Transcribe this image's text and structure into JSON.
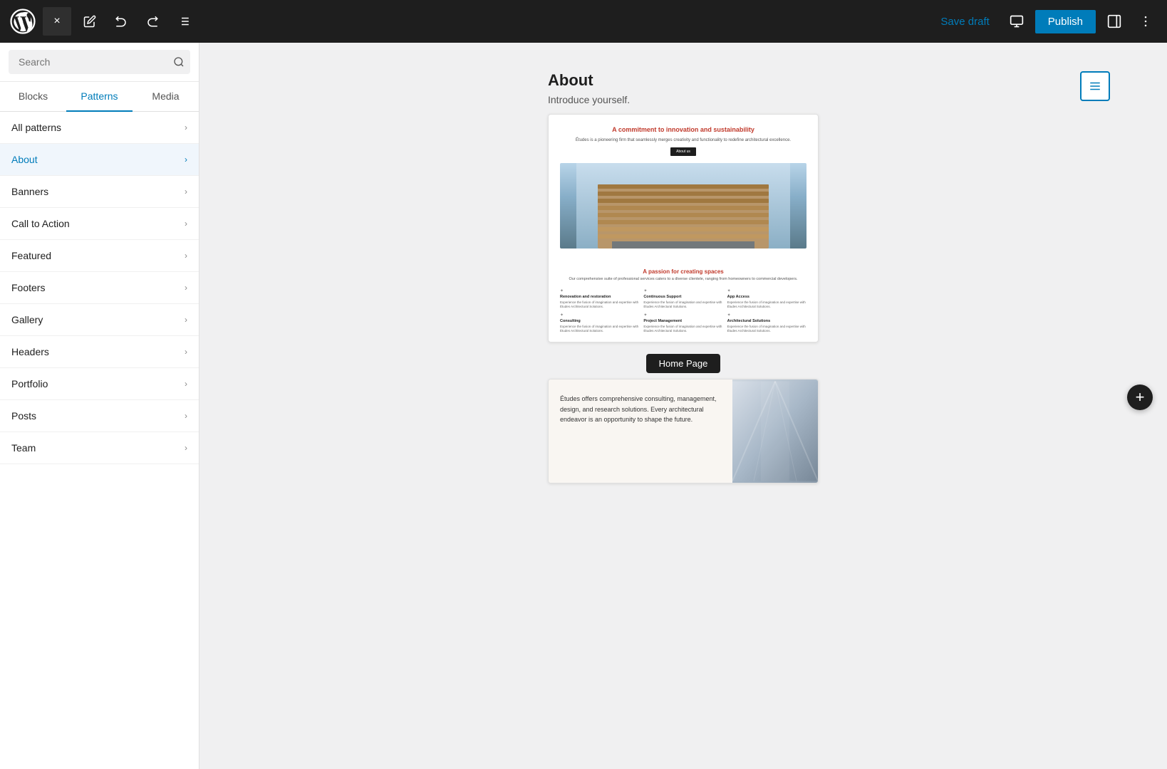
{
  "topbar": {
    "wp_logo_alt": "WordPress",
    "close_label": "×",
    "undo_label": "↩",
    "redo_label": "↪",
    "list_view_label": "≡",
    "save_draft_label": "Save draft",
    "preview_label": "Preview",
    "publish_label": "Publish",
    "sidebar_toggle_label": "Toggle sidebar",
    "more_options_label": "⋮"
  },
  "sidebar": {
    "search_placeholder": "Search",
    "tabs": [
      {
        "id": "blocks",
        "label": "Blocks"
      },
      {
        "id": "patterns",
        "label": "Patterns"
      },
      {
        "id": "media",
        "label": "Media"
      }
    ],
    "active_tab": "patterns",
    "pattern_categories": [
      {
        "id": "all-patterns",
        "label": "All patterns",
        "active": false
      },
      {
        "id": "about",
        "label": "About",
        "active": true
      },
      {
        "id": "banners",
        "label": "Banners",
        "active": false
      },
      {
        "id": "call-to-action",
        "label": "Call to Action",
        "active": false
      },
      {
        "id": "featured",
        "label": "Featured",
        "active": false
      },
      {
        "id": "footers",
        "label": "Footers",
        "active": false
      },
      {
        "id": "gallery",
        "label": "Gallery",
        "active": false
      },
      {
        "id": "headers",
        "label": "Headers",
        "active": false
      },
      {
        "id": "portfolio",
        "label": "Portfolio",
        "active": false
      },
      {
        "id": "posts",
        "label": "Posts",
        "active": false
      },
      {
        "id": "team",
        "label": "Team",
        "active": false
      }
    ]
  },
  "preview_panel": {
    "title": "About",
    "subtitle": "Introduce yourself.",
    "card1": {
      "heading": "A commitment to innovation and sustainability",
      "subtext": "Études is a pioneering firm that seamlessly merges creativity and functionality to redefine architectural excellence.",
      "button_label": "About us",
      "service_heading": "A passion for creating spaces",
      "service_subtext": "Our comprehensive suite of professional services caters to a diverse clientele, ranging from homeowners to commercial developers.",
      "services": [
        {
          "title": "Renovation and restoration",
          "desc": "Experience the fusion of imagination and expertise with Études Architectural Solutions."
        },
        {
          "title": "Continuous Support",
          "desc": "Experience the fusion of imagination and expertise with Études Architectural Solutions."
        },
        {
          "title": "App Access",
          "desc": "Experience the fusion of imagination and expertise with Études Architectural Solutions."
        },
        {
          "title": "Consulting",
          "desc": "Experience the fusion of imagination and expertise with Études Architectural Solutions."
        },
        {
          "title": "Project Management",
          "desc": "Experience the fusion of imagination and expertise with Études Architectural Solutions."
        },
        {
          "title": "Architectural Solutions",
          "desc": "Experience the fusion of imagination and expertise with Études Architectural Solutions."
        }
      ]
    },
    "home_page_badge": "Home Page",
    "card2": {
      "text": "Études offers comprehensive consulting, management, design, and research solutions. Every architectural endeavor is an opportunity to shape the future."
    }
  },
  "add_block": {
    "label": "+"
  }
}
